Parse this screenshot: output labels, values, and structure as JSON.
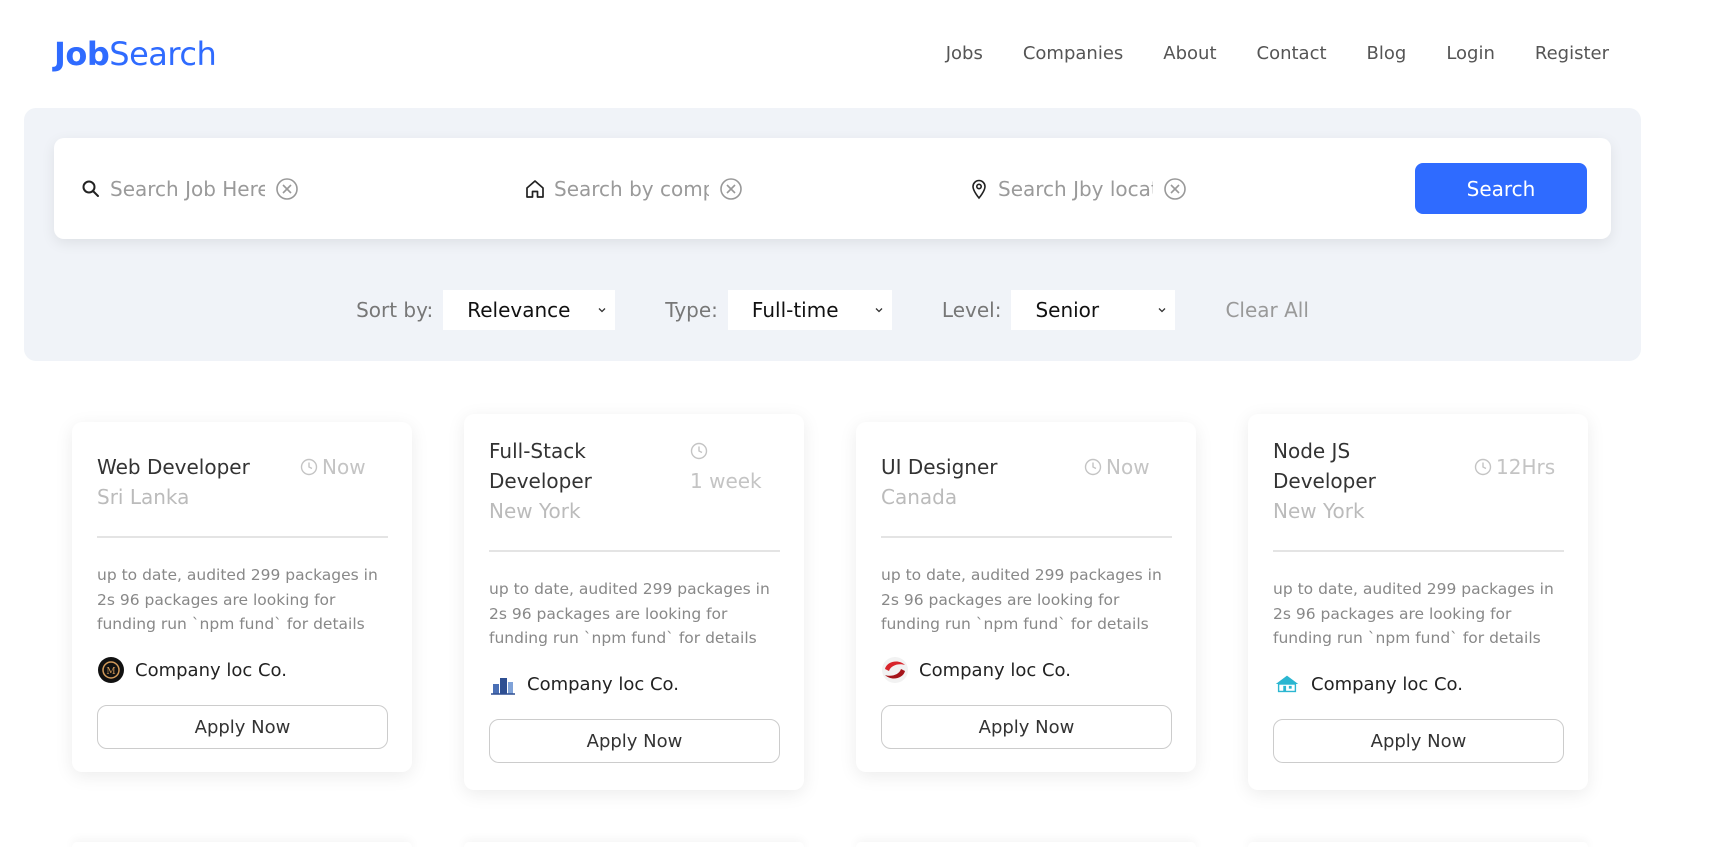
{
  "brand": {
    "part1": "Job",
    "part2": "Search"
  },
  "nav": [
    "Jobs",
    "Companies",
    "About",
    "Contact",
    "Blog",
    "Login",
    "Register"
  ],
  "search": {
    "job_placeholder": "Search Job Here",
    "company_placeholder": "Search by company",
    "location_placeholder": "Search Jby location",
    "button_label": "Search"
  },
  "filters": {
    "sort_label": "Sort by:",
    "sort_value": "Relevance",
    "type_label": "Type:",
    "type_value": "Full-time",
    "level_label": "Level:",
    "level_value": "Senior",
    "clear_label": "Clear All"
  },
  "jobs": [
    {
      "title": "Web Developer",
      "location": "Sri Lanka",
      "time": "Now",
      "description": "up to date, audited 299 packages in 2s 96 packages are looking for funding run `npm fund` for details",
      "company": "Company loc Co.",
      "apply": "Apply Now",
      "logo_icon": "circle-dark-logo"
    },
    {
      "title": "Full-Stack Developer",
      "location": "New York",
      "time": "1 week",
      "description": "up to date, audited 299 packages in 2s 96 packages are looking for funding run `npm fund` for details",
      "company": "Company loc Co.",
      "apply": "Apply Now",
      "logo_icon": "building-logo"
    },
    {
      "title": "UI Designer",
      "location": "Canada",
      "time": "Now",
      "description": "up to date, audited 299 packages in 2s 96 packages are looking for funding run `npm fund` for details",
      "company": "Company loc Co.",
      "apply": "Apply Now",
      "logo_icon": "red-swirl-logo"
    },
    {
      "title": "Node JS Developer",
      "location": "New York",
      "time": "12Hrs",
      "description": "up to date, audited 299 packages in 2s 96 packages are looking for funding run `npm fund` for details",
      "company": "Company loc Co.",
      "apply": "Apply Now",
      "logo_icon": "cyan-house-logo"
    }
  ],
  "colors": {
    "accent": "#2f6bff",
    "panel": "#f0f3f8"
  }
}
